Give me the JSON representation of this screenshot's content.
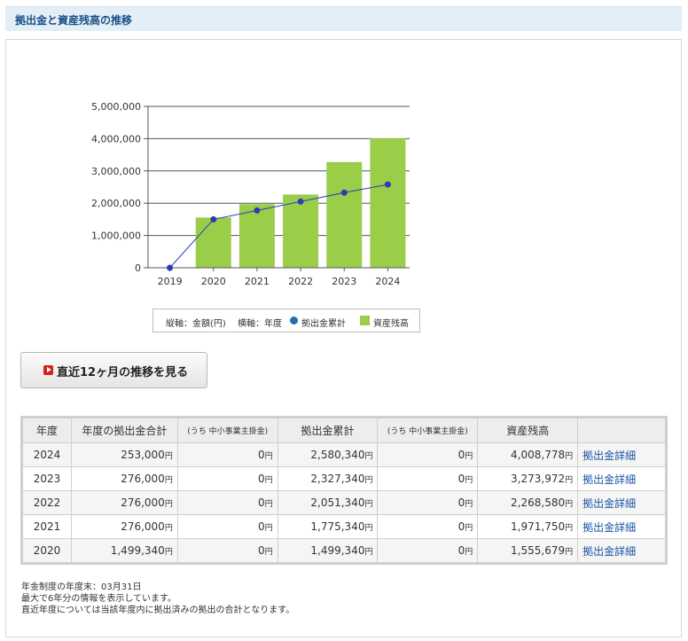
{
  "section": {
    "title": "拠出金と資産残高の推移"
  },
  "chart_data": {
    "type": "bar",
    "categories": [
      "2019",
      "2020",
      "2021",
      "2022",
      "2023",
      "2024"
    ],
    "ylim": [
      0,
      5000000
    ],
    "yticks": [
      "0",
      "1,000,000",
      "2,000,000",
      "3,000,000",
      "4,000,000",
      "5,000,000"
    ],
    "series": [
      {
        "name": "資産残高",
        "type": "bar",
        "color": "#9acd48",
        "values": [
          0,
          1555679,
          1971750,
          2268580,
          3273972,
          4008778
        ]
      },
      {
        "name": "拠出金累計",
        "type": "line",
        "color": "#1f6fb5",
        "values": [
          0,
          1499340,
          1775340,
          2051340,
          2327340,
          2580340
        ]
      }
    ]
  },
  "legend": {
    "vertical_axis": "縦軸：金額(円)",
    "horizontal_axis": "横軸：年度",
    "contrib_label": "拠出金累計",
    "assets_label": "資産残高"
  },
  "button_12m": {
    "label": "直近12ヶ月の推移を見る"
  },
  "table": {
    "headers": [
      "年度",
      "年度の拠出金合計",
      "(うち 中小事業主掛金)",
      "拠出金累計",
      "(うち 中小事業主掛金)",
      "資産残高",
      ""
    ],
    "unit": "円",
    "rows": [
      {
        "year": "2024",
        "annual": "253,000",
        "annual_sme": "0",
        "cumulative": "2,580,340",
        "cumulative_sme": "0",
        "assets": "4,008,778",
        "link": "拠出金詳細"
      },
      {
        "year": "2023",
        "annual": "276,000",
        "annual_sme": "0",
        "cumulative": "2,327,340",
        "cumulative_sme": "0",
        "assets": "3,273,972",
        "link": "拠出金詳細"
      },
      {
        "year": "2022",
        "annual": "276,000",
        "annual_sme": "0",
        "cumulative": "2,051,340",
        "cumulative_sme": "0",
        "assets": "2,268,580",
        "link": "拠出金詳細"
      },
      {
        "year": "2021",
        "annual": "276,000",
        "annual_sme": "0",
        "cumulative": "1,775,340",
        "cumulative_sme": "0",
        "assets": "1,971,750",
        "link": "拠出金詳細"
      },
      {
        "year": "2020",
        "annual": "1,499,340",
        "annual_sme": "0",
        "cumulative": "1,499,340",
        "cumulative_sme": "0",
        "assets": "1,555,679",
        "link": "拠出金詳細"
      }
    ]
  },
  "notes": [
    "年金制度の年度末：03月31日",
    "最大で6年分の情報を表示しています。",
    "直近年度については当該年度内に拠出済みの拠出の合計となります。"
  ]
}
